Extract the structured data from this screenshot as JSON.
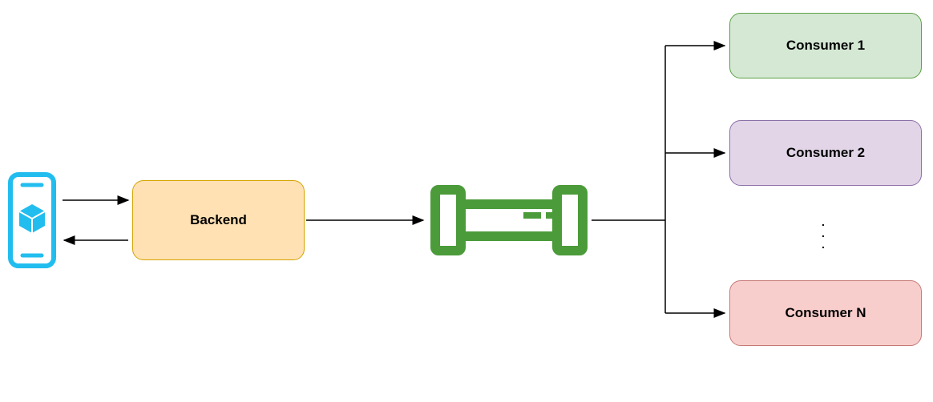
{
  "nodes": {
    "backend": {
      "label": "Backend"
    },
    "consumer1": {
      "label": "Consumer 1"
    },
    "consumer2": {
      "label": "Consumer 2"
    },
    "consumerN": {
      "label": "Consumer N"
    },
    "ellipsis": {
      "d1": ".",
      "d2": ".",
      "d3": "."
    }
  },
  "colors": {
    "phone": "#22bdef",
    "backend_fill": "#ffe1b3",
    "backend_stroke": "#d6a400",
    "queue": "#4b9b3a",
    "c1_fill": "#d5e8d4",
    "c1_stroke": "#5ba046",
    "c2_fill": "#e1d5e7",
    "c2_stroke": "#8b6fa8",
    "cn_fill": "#f8cecc",
    "cn_stroke": "#c47a77",
    "arrow": "#000000"
  }
}
